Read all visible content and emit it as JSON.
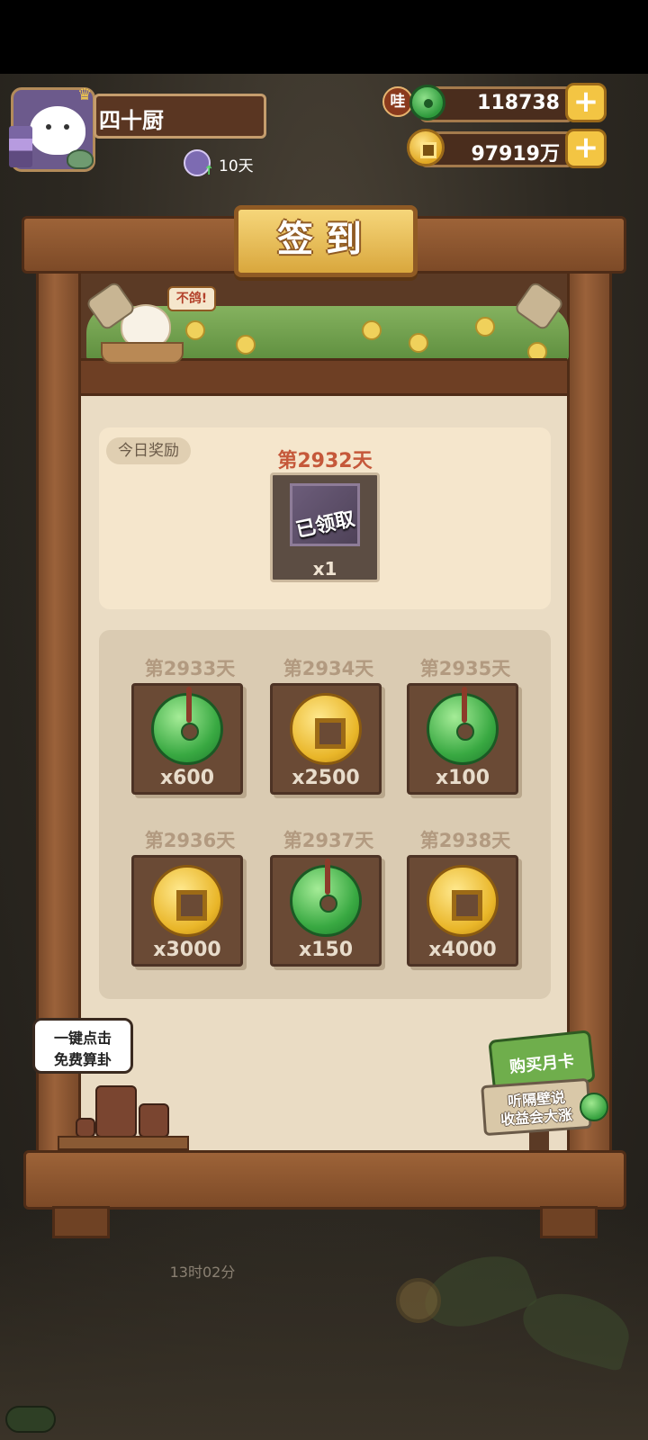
{
  "player": {
    "name": "四十厨",
    "streak": "10天"
  },
  "currency": {
    "badge": "哇",
    "jade_amount": "118738",
    "coin_amount": "97919万",
    "plus": "+"
  },
  "checkin": {
    "title": "签到",
    "roof_sign": "不鸽!",
    "today_tag": "今日奖励",
    "today": {
      "day": "第2932天",
      "status": "已领取",
      "qty": "x1"
    },
    "rewards": [
      {
        "day": "第2933天",
        "icon": "jade-icon",
        "qty": "x600"
      },
      {
        "day": "第2934天",
        "icon": "coin-icon",
        "qty": "x2500"
      },
      {
        "day": "第2935天",
        "icon": "jade-icon",
        "qty": "x100"
      },
      {
        "day": "第2936天",
        "icon": "coin-icon",
        "qty": "x3000"
      },
      {
        "day": "第2937天",
        "icon": "jade-icon",
        "qty": "x150"
      },
      {
        "day": "第2938天",
        "icon": "coin-icon",
        "qty": "x4000"
      }
    ]
  },
  "fortune_tip": {
    "line1": "一键点击",
    "line2": "免费算卦"
  },
  "month_card": {
    "title": "购买月卡",
    "line1": "听隔壁说",
    "line2": "收益会大涨"
  },
  "background": {
    "timer": "13时02分"
  },
  "colors": {
    "accent_gold": "#f3c543",
    "wood_dark": "#4e2c17",
    "today_day_red": "#c5583a",
    "jade_green": "#39a942"
  }
}
